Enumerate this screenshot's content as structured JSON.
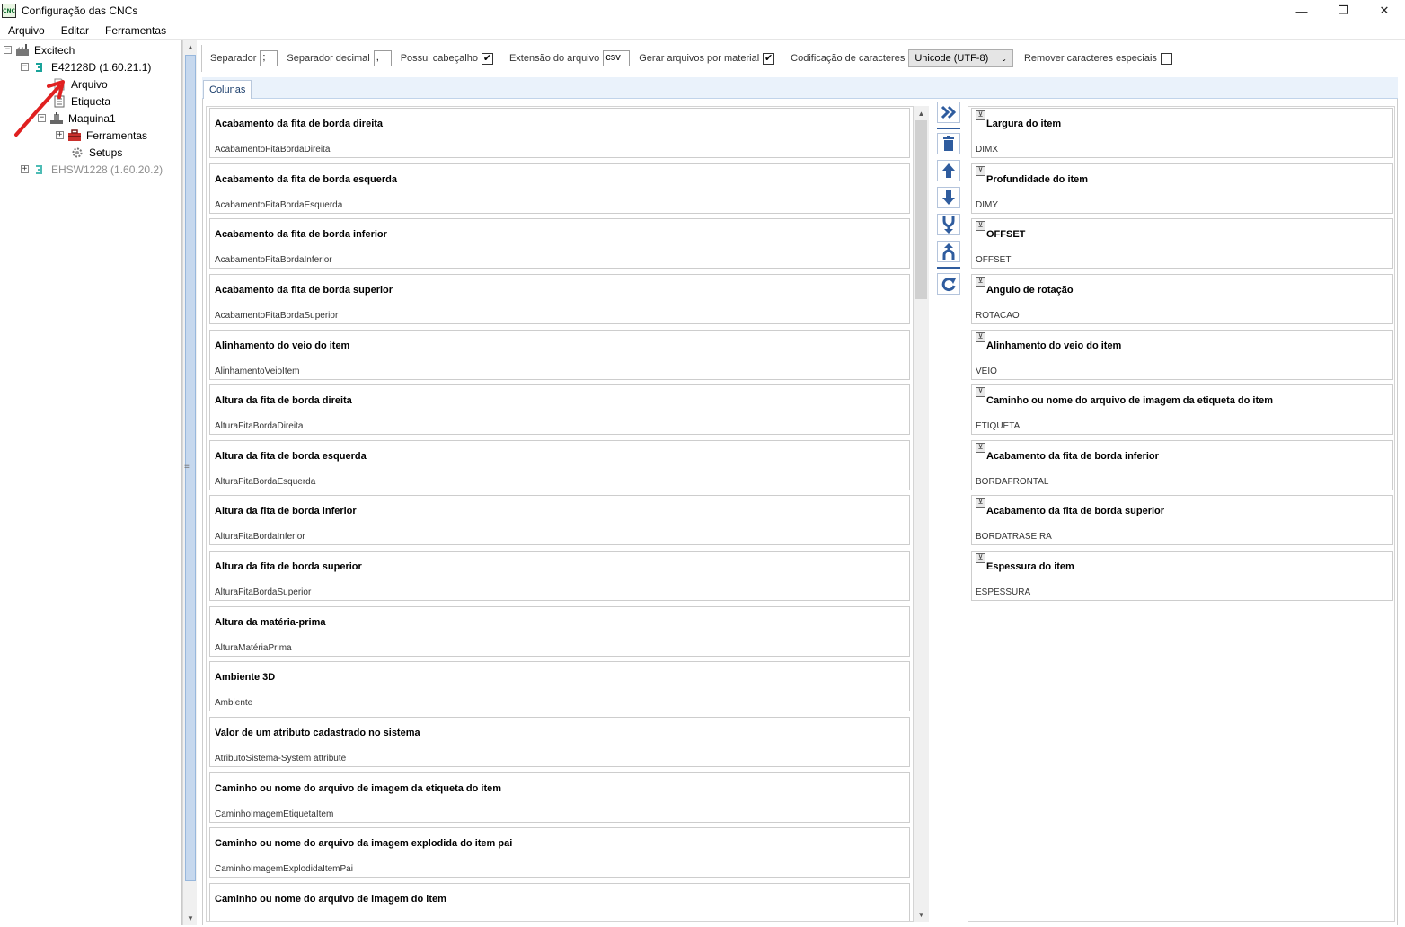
{
  "window": {
    "app_icon_text": "CNC",
    "title": "Configuração das CNCs",
    "minimize": "—",
    "restore": "❐",
    "close": "✕"
  },
  "menu": {
    "items": [
      "Arquivo",
      "Editar",
      "Ferramentas"
    ]
  },
  "tree": {
    "root": "Excitech",
    "machine1": "E42128D (1.60.21.1)",
    "arquivo": "Arquivo",
    "etiqueta": "Etiqueta",
    "maquina1": "Maquina1",
    "ferramentas": "Ferramentas",
    "setups": "Setups",
    "machine2": "EHSW1228 (1.60.20.2)",
    "expand_plus": "+",
    "expand_minus": "−"
  },
  "toolbar": {
    "separador_label": "Separador",
    "separador_value": ";",
    "sep_decimal_label": "Separador decimal",
    "sep_decimal_value": ",",
    "cabecalho_label": "Possui cabeçalho",
    "cabecalho_checked": "✔",
    "extensao_label": "Extensão do arquivo",
    "extensao_value": "csv",
    "gerar_label": "Gerar arquivos por material",
    "gerar_checked": "✔",
    "codificacao_label": "Codificação de caracteres",
    "codificacao_value": "Unicode (UTF-8)",
    "remover_label": "Remover caracteres especiais",
    "remover_checked": ""
  },
  "tabs": [
    "Colunas"
  ],
  "available_columns": [
    {
      "title": "Acabamento da fita de borda direita",
      "key": "AcabamentoFitaBordaDireita"
    },
    {
      "title": "Acabamento da fita de borda esquerda",
      "key": "AcabamentoFitaBordaEsquerda"
    },
    {
      "title": "Acabamento da fita de borda inferior",
      "key": "AcabamentoFitaBordaInferior"
    },
    {
      "title": "Acabamento da fita de borda superior",
      "key": "AcabamentoFitaBordaSuperior"
    },
    {
      "title": "Alinhamento do veio do item",
      "key": "AlinhamentoVeioItem"
    },
    {
      "title": "Altura da fita de borda direita",
      "key": "AlturaFitaBordaDireita"
    },
    {
      "title": "Altura da fita de borda esquerda",
      "key": "AlturaFitaBordaEsquerda"
    },
    {
      "title": "Altura da fita de borda inferior",
      "key": "AlturaFitaBordaInferior"
    },
    {
      "title": "Altura da fita de borda superior",
      "key": "AlturaFitaBordaSuperior"
    },
    {
      "title": "Altura da matéria-prima",
      "key": "AlturaMatériaPrima"
    },
    {
      "title": "Ambiente 3D",
      "key": "Ambiente"
    },
    {
      "title": "Valor de um atributo cadastrado no sistema",
      "key": "AtributoSistema-System attribute"
    },
    {
      "title": "Caminho ou nome do arquivo de imagem da etiqueta do item",
      "key": "CaminhoImagemEtiquetaItem"
    },
    {
      "title": "Caminho ou nome do arquivo da imagem explodida do item pai",
      "key": "CaminhoImagemExplodidaItemPai"
    },
    {
      "title": "Caminho ou nome do arquivo de imagem do item",
      "key": ""
    }
  ],
  "selected_columns": [
    {
      "title": "Largura do item",
      "key": "DIMX"
    },
    {
      "title": "Profundidade do item",
      "key": "DIMY"
    },
    {
      "title": "OFFSET",
      "key": "OFFSET"
    },
    {
      "title": "Angulo de rotação",
      "key": "ROTACAO"
    },
    {
      "title": "Alinhamento do veio do item",
      "key": "VEIO"
    },
    {
      "title": "Caminho ou nome do arquivo de imagem da etiqueta do item",
      "key": "ETIQUETA"
    },
    {
      "title": "Acabamento da fita de borda inferior",
      "key": "BORDAFRONTAL"
    },
    {
      "title": "Acabamento da fita de borda superior",
      "key": "BORDATRASEIRA"
    },
    {
      "title": "Espessura do item",
      "key": "ESPESSURA"
    }
  ],
  "icons": {
    "selected_item_icon": "⊻",
    "scroll_up": "▲",
    "scroll_down": "▼",
    "select_chevron": "⌄",
    "splitter": "≡"
  },
  "colors": {
    "selection": "#f5c542",
    "accent_blue": "#2f5c9e",
    "tab_bg": "#eaf2fb"
  }
}
